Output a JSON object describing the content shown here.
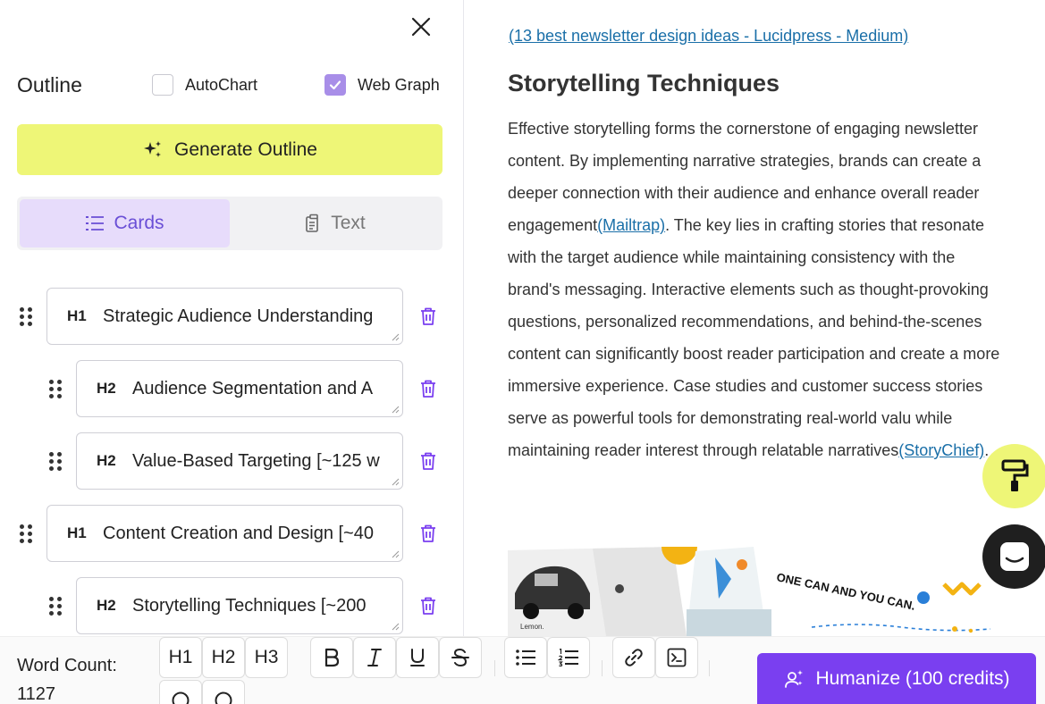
{
  "outline": {
    "title": "Outline",
    "autochart_label": "AutoChart",
    "webgraph_label": "Web Graph",
    "generate_label": "Generate Outline",
    "tabs": [
      {
        "label": "Cards",
        "active": true
      },
      {
        "label": "Text",
        "active": false
      }
    ],
    "items": [
      {
        "level": "H1",
        "text": "Strategic Audience Understanding"
      },
      {
        "level": "H2",
        "text": "Audience Segmentation and A"
      },
      {
        "level": "H2",
        "text": "Value-Based Targeting [~125 w"
      },
      {
        "level": "H1",
        "text": "Content Creation and Design [~40"
      },
      {
        "level": "H2",
        "text": "Storytelling Techniques [~200"
      }
    ]
  },
  "article": {
    "source_link": "(13 best newsletter design ideas - Lucidpress - Medium)",
    "section_title": "Storytelling Techniques",
    "para_1": "Effective storytelling forms the cornerstone of engaging newsletter content. By implementing narrative strategies, brands can create a deeper connection with their audience and enhance overall reader engagement",
    "link_1": "(Mailtrap)",
    "para_2": ". The key lies in crafting stories that resonate with the target audience while maintaining consistency with the brand's messaging. Interactive elements such as thought-provoking questions, personalized recommendations, and behind-the-scenes content can significantly boost reader participation and create a more immersive experience. Case studies and customer success stories serve as powerful tools for demonstrating real-world valu while maintaining reader interest through relatable narratives",
    "link_2": "(StoryChief)",
    "para_end": ".",
    "image_text": "ONE CAN AND YOU CAN.",
    "image_caption": "Lemon."
  },
  "toolbar": {
    "word_count_label": "Word Count:",
    "word_count_value": "1127",
    "h1": "H1",
    "h2": "H2",
    "h3": "H3",
    "humanize_label": "Humanize (100 credits)"
  },
  "colors": {
    "accent": "#7a3ff0",
    "highlight": "#eef677",
    "tab_active": "#e7dcfb",
    "link": "#1a6fa8"
  }
}
